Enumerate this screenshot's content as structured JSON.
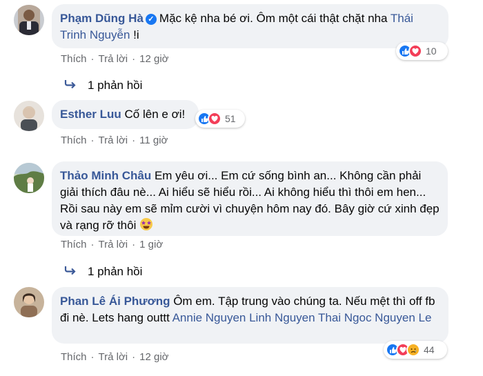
{
  "comments": [
    {
      "author": "Phạm Dũng Hà",
      "text": "Mặc kệ nha bé ơi. Ôm một cái thật chặt nha ",
      "tag": "Thái Trinh Nguyễn",
      "suffix": " !i",
      "like_label": "Thích",
      "reply_label": "Trả lời",
      "time": "12 giờ",
      "reaction_count": "10",
      "replies_label": "1 phản hồi",
      "reactions": [
        "like-icon",
        "love-icon"
      ]
    },
    {
      "author": "Esther Luu",
      "text": "Cố lên e ơi!",
      "like_label": "Thích",
      "reply_label": "Trả lời",
      "time": "11 giờ",
      "reaction_count": "51",
      "reactions": [
        "like-icon",
        "love-icon"
      ]
    },
    {
      "author": "Thảo Minh Châu",
      "text": "Em yêu ơi... Em cứ sống bình an... Không cần phải giải thích đâu nè... Ai hiểu sẽ hiểu rồi... Ai không hiểu thì thôi em hen... Rồi sau này em sẽ mỉm cười vì chuyện hôm nay đó. Bây giờ cứ xinh đẹp và rạng rỡ thôi",
      "like_label": "Thích",
      "reply_label": "Trả lời",
      "time": "1 giờ",
      "replies_label": "1 phản hồi",
      "emoji": "star-struck-emoji"
    },
    {
      "author": "Phan Lê Ái Phương",
      "text": "Ôm em. Tập trung vào chúng ta. Nếu mệt thì off fb đi nè. Lets hang outtt ",
      "tags": "Annie Nguyen Linh Nguyen Thai Ngoc Nguyen Le",
      "like_label": "Thích",
      "reply_label": "Trả lời",
      "time": "12 giờ",
      "reaction_count": "44",
      "reactions": [
        "like-icon",
        "love-icon",
        "sad-icon"
      ]
    }
  ],
  "colors": {
    "link": "#385898",
    "bubble": "#f0f2f5",
    "meta": "#65676b",
    "like": "#1877f2",
    "love": "#f33e58"
  }
}
